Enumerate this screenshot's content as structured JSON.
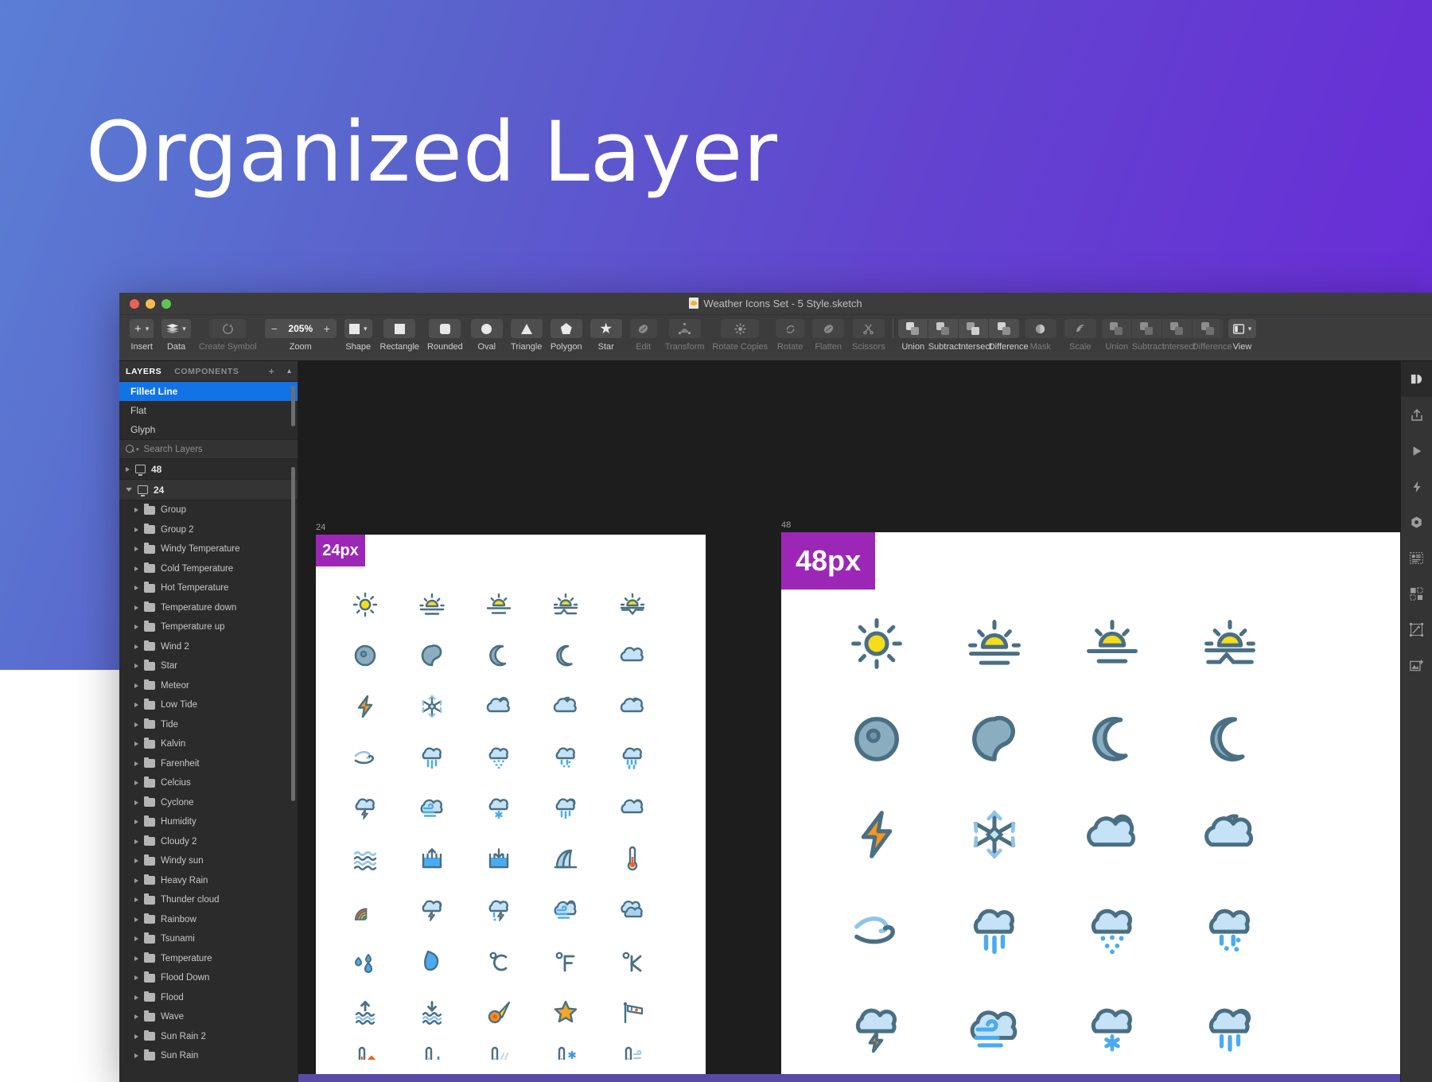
{
  "hero": {
    "title": "Organized Layer"
  },
  "window": {
    "title": "Weather Icons Set - 5 Style.sketch",
    "doc_icon": "sketch-document-icon",
    "traffic_lights": [
      "close-button",
      "minimize-button",
      "zoom-button"
    ]
  },
  "toolbar": {
    "groups": [
      {
        "label": "Insert",
        "icon": "plus-icon",
        "dropdown": true,
        "disabled": false
      },
      {
        "label": "Data",
        "icon": "layers-icon",
        "dropdown": true,
        "disabled": false
      },
      {
        "label": "Create Symbol",
        "icon": "create-symbol-icon",
        "dropdown": false,
        "disabled": true
      },
      {
        "label": "Zoom",
        "icon": "zoom-stepper",
        "dropdown": false,
        "disabled": false
      },
      {
        "label": "Shape",
        "icon": "square-icon",
        "dropdown": true,
        "disabled": false
      }
    ],
    "zoom_value": "205%",
    "zoom_minus": "−",
    "zoom_plus": "+",
    "shape_tools": [
      {
        "label": "Rectangle",
        "icon": "rectangle-icon",
        "disabled": false
      },
      {
        "label": "Rounded",
        "icon": "rounded-rectangle-icon",
        "disabled": false
      },
      {
        "label": "Oval",
        "icon": "oval-icon",
        "disabled": false
      },
      {
        "label": "Triangle",
        "icon": "triangle-icon",
        "disabled": false
      },
      {
        "label": "Polygon",
        "icon": "polygon-icon",
        "disabled": false
      },
      {
        "label": "Star",
        "icon": "star-icon",
        "disabled": false
      }
    ],
    "edit_tools": [
      {
        "label": "Edit",
        "icon": "edit-icon",
        "disabled": true
      },
      {
        "label": "Transform",
        "icon": "transform-icon",
        "disabled": true
      },
      {
        "label": "Rotate Copies",
        "icon": "rotate-copies-icon",
        "disabled": true
      },
      {
        "label": "Rotate",
        "icon": "rotate-icon",
        "disabled": true
      },
      {
        "label": "Flatten",
        "icon": "flatten-icon",
        "disabled": true
      },
      {
        "label": "Scissors",
        "icon": "scissors-icon",
        "disabled": true
      }
    ],
    "boolean_tools": [
      {
        "label": "Union",
        "icon": "union-icon",
        "disabled": false
      },
      {
        "label": "Subtract",
        "icon": "subtract-icon",
        "disabled": false
      },
      {
        "label": "Intersect",
        "icon": "intersect-icon",
        "disabled": false
      },
      {
        "label": "Difference",
        "icon": "difference-icon",
        "disabled": false
      }
    ],
    "mask_tools": [
      {
        "label": "Mask",
        "icon": "mask-icon",
        "disabled": true
      },
      {
        "label": "Scale",
        "icon": "scale-icon",
        "disabled": true
      }
    ],
    "boolean_tools_2": [
      {
        "label": "Union",
        "icon": "union-icon",
        "disabled": true
      },
      {
        "label": "Subtract",
        "icon": "subtract-icon",
        "disabled": true
      },
      {
        "label": "Intersect",
        "icon": "intersect-icon",
        "disabled": true
      },
      {
        "label": "Difference",
        "icon": "difference-icon",
        "disabled": true
      }
    ],
    "view": {
      "label": "View",
      "icon": "view-icon",
      "dropdown": true
    }
  },
  "left_panel": {
    "tabs": [
      {
        "label": "LAYERS",
        "active": true
      },
      {
        "label": "COMPONENTS",
        "active": false
      }
    ],
    "add_icon": "plus-icon",
    "collapse_icon": "chevron-up-icon",
    "pages": [
      {
        "label": "Filled Line",
        "selected": true
      },
      {
        "label": "Flat",
        "selected": false
      },
      {
        "label": "Glyph",
        "selected": false
      }
    ],
    "search": {
      "placeholder": "Search Layers",
      "icon": "search-icon",
      "value": ""
    },
    "tree": [
      {
        "label": "48",
        "type": "artboard",
        "expanded": false
      },
      {
        "label": "24",
        "type": "artboard",
        "expanded": true
      },
      {
        "label": "Group",
        "type": "group"
      },
      {
        "label": "Group 2",
        "type": "group"
      },
      {
        "label": "Windy Temperature",
        "type": "group"
      },
      {
        "label": "Cold Temperature",
        "type": "group"
      },
      {
        "label": "Hot Temperature",
        "type": "group"
      },
      {
        "label": "Temperature down",
        "type": "group"
      },
      {
        "label": "Temperature up",
        "type": "group"
      },
      {
        "label": "Wind 2",
        "type": "group"
      },
      {
        "label": "Star",
        "type": "group"
      },
      {
        "label": "Meteor",
        "type": "group"
      },
      {
        "label": "Low Tide",
        "type": "group"
      },
      {
        "label": "Tide",
        "type": "group"
      },
      {
        "label": "Kalvin",
        "type": "group"
      },
      {
        "label": "Farenheit",
        "type": "group"
      },
      {
        "label": "Celcius",
        "type": "group"
      },
      {
        "label": "Cyclone",
        "type": "group"
      },
      {
        "label": "Humidity",
        "type": "group"
      },
      {
        "label": "Cloudy 2",
        "type": "group"
      },
      {
        "label": "Windy sun",
        "type": "group"
      },
      {
        "label": "Heavy Rain",
        "type": "group"
      },
      {
        "label": "Thunder cloud",
        "type": "group"
      },
      {
        "label": "Rainbow",
        "type": "group"
      },
      {
        "label": "Tsunami",
        "type": "group"
      },
      {
        "label": "Temperature",
        "type": "group"
      },
      {
        "label": "Flood Down",
        "type": "group"
      },
      {
        "label": "Flood",
        "type": "group"
      },
      {
        "label": "Wave",
        "type": "group"
      },
      {
        "label": "Sun Rain 2",
        "type": "group"
      },
      {
        "label": "Sun Rain",
        "type": "group"
      }
    ]
  },
  "canvas": {
    "artboard_24": {
      "name": "24",
      "badge": "24px"
    },
    "artboard_48": {
      "name": "48",
      "badge": "48px"
    },
    "badge_color": "#9c27b7",
    "icon_colors": {
      "stroke": "#4a6f83",
      "cloud_fill": "#c5e2f7",
      "moon_fill": "#8aadbf",
      "sun_yellow": "#f5dd1b",
      "rain_blue": "#4aabf0",
      "orange": "#f79420",
      "water_blue": "#4aabf0"
    },
    "grid_24": [
      [
        "sun",
        "sunrise",
        "sunset",
        "sunrise-hill",
        "sunset-valley"
      ],
      [
        "eclipse",
        "moon-gibbous",
        "moon-crescent",
        "moon-crescent-2",
        "cloud"
      ],
      [
        "lightning",
        "snowflake",
        "cloud-sun",
        "cloud-moon",
        "cloud-cloud"
      ],
      [
        "wind",
        "cloud-rain",
        "cloud-drizzle",
        "cloud-sleet",
        "cloud-showers"
      ],
      [
        "cloud-lightning",
        "cloud-wind",
        "cloud-snow",
        "cloud-sun-rain",
        "cloud-sun-2"
      ],
      [
        "waves",
        "high-tide",
        "low-tide",
        "tsunami",
        "thermometer"
      ],
      [
        "rainbow",
        "cloud-sun-lightning",
        "cloud-rain-lightning",
        "cloud-sun-wind",
        "clouds"
      ],
      [
        "humidity",
        "water-drop",
        "celsius",
        "fahrenheit",
        "kelvin"
      ],
      [
        "flood-up",
        "flood-down",
        "meteor",
        "star",
        "windsock"
      ],
      [
        "temp-up",
        "temp-down",
        "temp-heat",
        "temp-cold",
        "temp-wind"
      ]
    ],
    "grid_48": [
      [
        "sun",
        "sunrise",
        "sunset",
        "sunrise-hill"
      ],
      [
        "eclipse",
        "moon-gibbous",
        "moon-crescent",
        "moon-crescent-2"
      ],
      [
        "lightning",
        "snowflake",
        "cloud-sun",
        "cloud-moon"
      ],
      [
        "wind",
        "cloud-rain",
        "cloud-drizzle",
        "cloud-sleet"
      ],
      [
        "cloud-lightning",
        "cloud-wind",
        "cloud-snow",
        "cloud-sun-rain"
      ]
    ]
  },
  "right_rail": {
    "items": [
      {
        "icon": "inspector-icon",
        "active": true
      },
      {
        "icon": "export-icon",
        "active": false
      },
      {
        "icon": "play-icon",
        "active": false
      },
      {
        "icon": "prototype-icon",
        "active": false
      },
      {
        "icon": "component-icon",
        "active": false
      },
      {
        "icon": "layout-icon",
        "active": false
      },
      {
        "icon": "grid-icon",
        "active": false
      },
      {
        "icon": "edit-shape-icon",
        "active": false
      },
      {
        "icon": "add-image-icon",
        "active": false
      }
    ]
  }
}
